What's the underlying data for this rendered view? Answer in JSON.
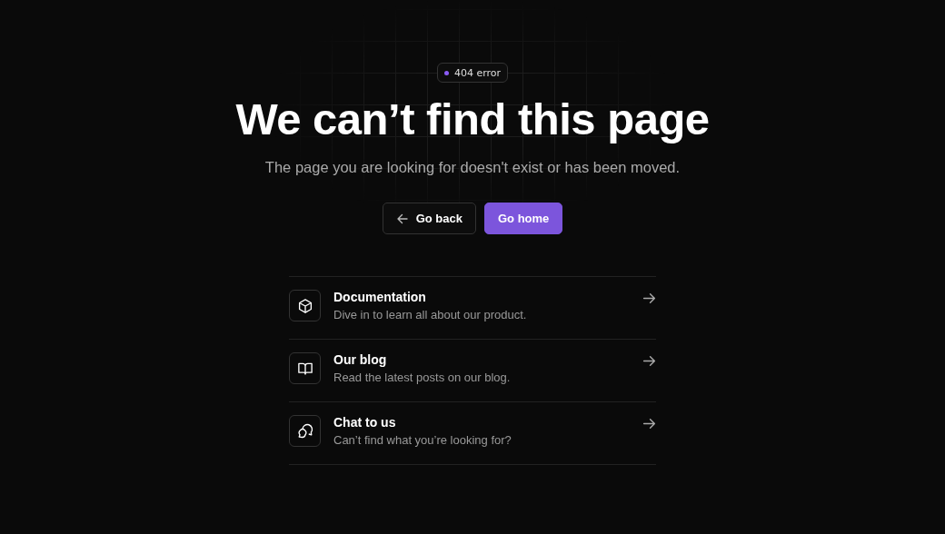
{
  "badge": {
    "label": "404 error",
    "color": "#8b5cf6"
  },
  "heading": "We can’t find this page",
  "subtitle": "The page you are looking for doesn't exist or has been moved.",
  "buttons": [
    {
      "label": "Go back",
      "kind": "secondary"
    },
    {
      "label": "Go home",
      "kind": "primary"
    }
  ],
  "links": [
    {
      "title": "Documentation",
      "description": "Dive in to learn all about our product."
    },
    {
      "title": "Our blog",
      "description": "Read the latest posts on our blog."
    },
    {
      "title": "Chat to us",
      "description": "Can’t find what you’re looking for?"
    }
  ]
}
